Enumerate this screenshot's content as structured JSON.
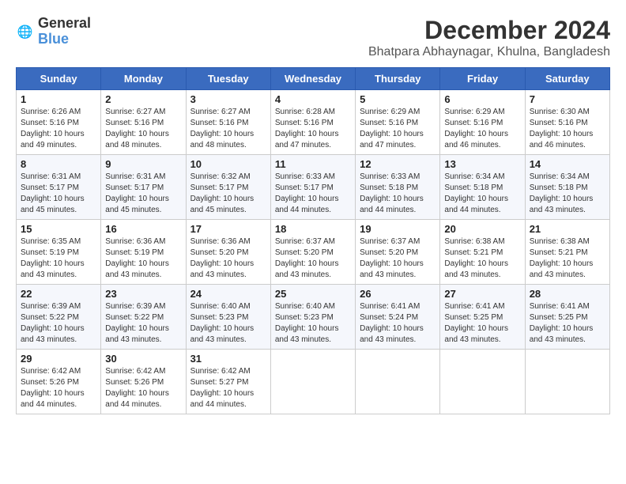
{
  "logo": {
    "general": "General",
    "blue": "Blue"
  },
  "title": "December 2024",
  "location": "Bhatpara Abhaynagar, Khulna, Bangladesh",
  "days_of_week": [
    "Sunday",
    "Monday",
    "Tuesday",
    "Wednesday",
    "Thursday",
    "Friday",
    "Saturday"
  ],
  "weeks": [
    [
      {
        "day": "1",
        "sunrise": "6:26 AM",
        "sunset": "5:16 PM",
        "daylight": "10 hours and 49 minutes."
      },
      {
        "day": "2",
        "sunrise": "6:27 AM",
        "sunset": "5:16 PM",
        "daylight": "10 hours and 48 minutes."
      },
      {
        "day": "3",
        "sunrise": "6:27 AM",
        "sunset": "5:16 PM",
        "daylight": "10 hours and 48 minutes."
      },
      {
        "day": "4",
        "sunrise": "6:28 AM",
        "sunset": "5:16 PM",
        "daylight": "10 hours and 47 minutes."
      },
      {
        "day": "5",
        "sunrise": "6:29 AM",
        "sunset": "5:16 PM",
        "daylight": "10 hours and 47 minutes."
      },
      {
        "day": "6",
        "sunrise": "6:29 AM",
        "sunset": "5:16 PM",
        "daylight": "10 hours and 46 minutes."
      },
      {
        "day": "7",
        "sunrise": "6:30 AM",
        "sunset": "5:16 PM",
        "daylight": "10 hours and 46 minutes."
      }
    ],
    [
      {
        "day": "8",
        "sunrise": "6:31 AM",
        "sunset": "5:17 PM",
        "daylight": "10 hours and 45 minutes."
      },
      {
        "day": "9",
        "sunrise": "6:31 AM",
        "sunset": "5:17 PM",
        "daylight": "10 hours and 45 minutes."
      },
      {
        "day": "10",
        "sunrise": "6:32 AM",
        "sunset": "5:17 PM",
        "daylight": "10 hours and 45 minutes."
      },
      {
        "day": "11",
        "sunrise": "6:33 AM",
        "sunset": "5:17 PM",
        "daylight": "10 hours and 44 minutes."
      },
      {
        "day": "12",
        "sunrise": "6:33 AM",
        "sunset": "5:18 PM",
        "daylight": "10 hours and 44 minutes."
      },
      {
        "day": "13",
        "sunrise": "6:34 AM",
        "sunset": "5:18 PM",
        "daylight": "10 hours and 44 minutes."
      },
      {
        "day": "14",
        "sunrise": "6:34 AM",
        "sunset": "5:18 PM",
        "daylight": "10 hours and 43 minutes."
      }
    ],
    [
      {
        "day": "15",
        "sunrise": "6:35 AM",
        "sunset": "5:19 PM",
        "daylight": "10 hours and 43 minutes."
      },
      {
        "day": "16",
        "sunrise": "6:36 AM",
        "sunset": "5:19 PM",
        "daylight": "10 hours and 43 minutes."
      },
      {
        "day": "17",
        "sunrise": "6:36 AM",
        "sunset": "5:20 PM",
        "daylight": "10 hours and 43 minutes."
      },
      {
        "day": "18",
        "sunrise": "6:37 AM",
        "sunset": "5:20 PM",
        "daylight": "10 hours and 43 minutes."
      },
      {
        "day": "19",
        "sunrise": "6:37 AM",
        "sunset": "5:20 PM",
        "daylight": "10 hours and 43 minutes."
      },
      {
        "day": "20",
        "sunrise": "6:38 AM",
        "sunset": "5:21 PM",
        "daylight": "10 hours and 43 minutes."
      },
      {
        "day": "21",
        "sunrise": "6:38 AM",
        "sunset": "5:21 PM",
        "daylight": "10 hours and 43 minutes."
      }
    ],
    [
      {
        "day": "22",
        "sunrise": "6:39 AM",
        "sunset": "5:22 PM",
        "daylight": "10 hours and 43 minutes."
      },
      {
        "day": "23",
        "sunrise": "6:39 AM",
        "sunset": "5:22 PM",
        "daylight": "10 hours and 43 minutes."
      },
      {
        "day": "24",
        "sunrise": "6:40 AM",
        "sunset": "5:23 PM",
        "daylight": "10 hours and 43 minutes."
      },
      {
        "day": "25",
        "sunrise": "6:40 AM",
        "sunset": "5:23 PM",
        "daylight": "10 hours and 43 minutes."
      },
      {
        "day": "26",
        "sunrise": "6:41 AM",
        "sunset": "5:24 PM",
        "daylight": "10 hours and 43 minutes."
      },
      {
        "day": "27",
        "sunrise": "6:41 AM",
        "sunset": "5:25 PM",
        "daylight": "10 hours and 43 minutes."
      },
      {
        "day": "28",
        "sunrise": "6:41 AM",
        "sunset": "5:25 PM",
        "daylight": "10 hours and 43 minutes."
      }
    ],
    [
      {
        "day": "29",
        "sunrise": "6:42 AM",
        "sunset": "5:26 PM",
        "daylight": "10 hours and 44 minutes."
      },
      {
        "day": "30",
        "sunrise": "6:42 AM",
        "sunset": "5:26 PM",
        "daylight": "10 hours and 44 minutes."
      },
      {
        "day": "31",
        "sunrise": "6:42 AM",
        "sunset": "5:27 PM",
        "daylight": "10 hours and 44 minutes."
      },
      null,
      null,
      null,
      null
    ]
  ]
}
